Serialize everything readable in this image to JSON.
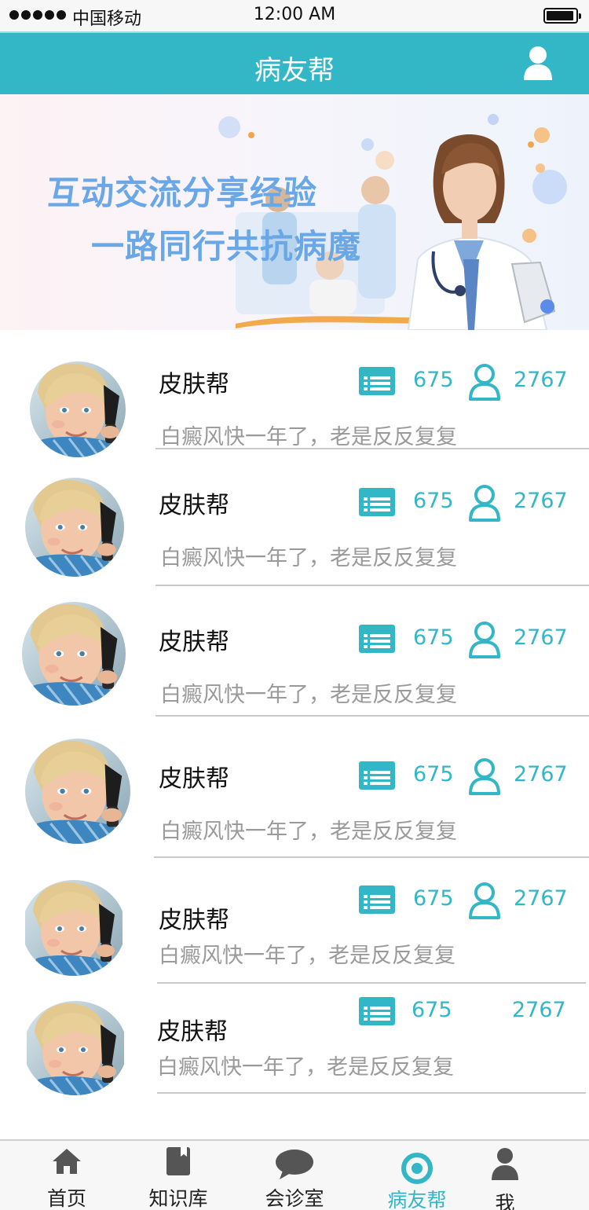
{
  "status_bar": {
    "carrier": "中国移动",
    "time": "12:00 AM"
  },
  "nav": {
    "title": "病友帮",
    "right_icon": "user-icon"
  },
  "banner": {
    "line1": "互动交流分享经验",
    "line2": "一路同行共抗病魔"
  },
  "groups": [
    {
      "name": "皮肤帮",
      "preview": "白癜风快一年了，老是反反复复",
      "posts": "675",
      "members": "2767"
    },
    {
      "name": "皮肤帮",
      "preview": "白癜风快一年了，老是反反复复",
      "posts": "675",
      "members": "2767"
    },
    {
      "name": "皮肤帮",
      "preview": "白癜风快一年了，老是反反复复",
      "posts": "675",
      "members": "2767"
    },
    {
      "name": "皮肤帮",
      "preview": "白癜风快一年了，老是反反复复",
      "posts": "675",
      "members": "2767"
    },
    {
      "name": "皮肤帮",
      "preview": "白癜风快一年了，老是反反复复",
      "posts": "675",
      "members": "2767"
    },
    {
      "name": "皮肤帮",
      "preview": "白癜风快一年了，老是反反复复",
      "posts": "675",
      "members": "2767"
    }
  ],
  "tabs": [
    {
      "label": "首页",
      "icon": "home-icon"
    },
    {
      "label": "知识库",
      "icon": "book-icon"
    },
    {
      "label": "会诊室",
      "icon": "chat-bubble-icon"
    },
    {
      "label": "病友帮",
      "icon": "target-icon",
      "active": true
    },
    {
      "label": "我",
      "icon": "user-icon"
    }
  ],
  "colors": {
    "accent": "#33b6c6",
    "banner_text": "#6aa7e6",
    "muted_text": "#9a9a9a",
    "tab_icon": "#555555"
  }
}
